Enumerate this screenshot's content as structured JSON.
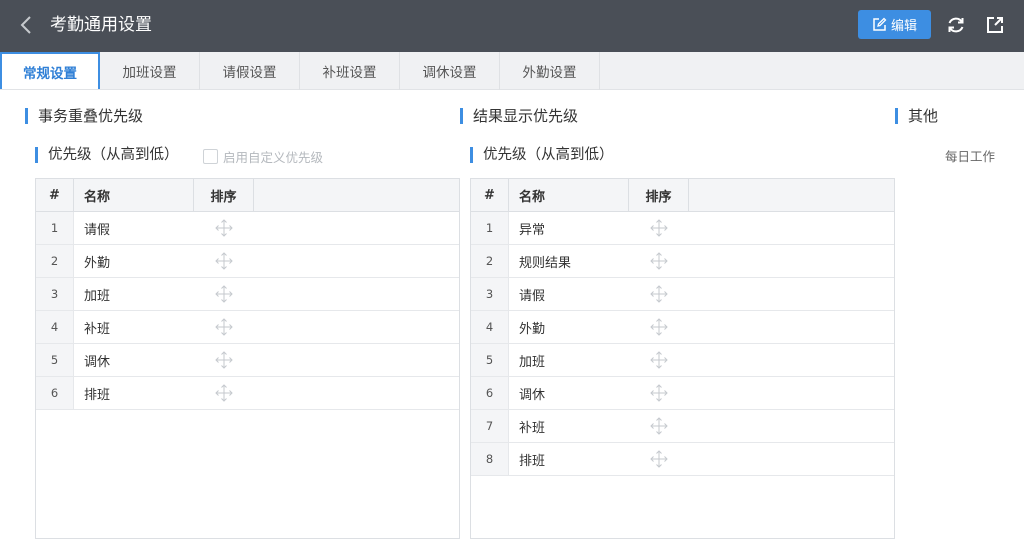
{
  "header": {
    "title": "考勤通用设置",
    "edit_label": "编辑",
    "back_icon": "chevron-left-icon",
    "refresh_icon": "refresh-icon",
    "export_icon": "external-link-icon"
  },
  "tabs": [
    {
      "label": "常规设置",
      "active": true
    },
    {
      "label": "加班设置"
    },
    {
      "label": "请假设置"
    },
    {
      "label": "补班设置"
    },
    {
      "label": "调休设置"
    },
    {
      "label": "外勤设置"
    }
  ],
  "left": {
    "section_title": "事务重叠优先级",
    "sub_title": "优先级（从高到低）",
    "custom_priority_label": "启用自定义优先级",
    "columns": {
      "num": "#",
      "name": "名称",
      "sort": "排序"
    },
    "rows": [
      {
        "num": "1",
        "name": "请假"
      },
      {
        "num": "2",
        "name": "外勤"
      },
      {
        "num": "3",
        "name": "加班"
      },
      {
        "num": "4",
        "name": "补班"
      },
      {
        "num": "5",
        "name": "调休"
      },
      {
        "num": "6",
        "name": "排班"
      }
    ]
  },
  "middle": {
    "section_title": "结果显示优先级",
    "sub_title": "优先级（从高到低）",
    "columns": {
      "num": "#",
      "name": "名称",
      "sort": "排序"
    },
    "rows": [
      {
        "num": "1",
        "name": "异常"
      },
      {
        "num": "2",
        "name": "规则结果"
      },
      {
        "num": "3",
        "name": "请假"
      },
      {
        "num": "4",
        "name": "外勤"
      },
      {
        "num": "5",
        "name": "加班"
      },
      {
        "num": "6",
        "name": "调休"
      },
      {
        "num": "7",
        "name": "补班"
      },
      {
        "num": "8",
        "name": "排班"
      }
    ]
  },
  "right": {
    "section_title": "其他",
    "item_text": "每日工作"
  },
  "colors": {
    "header_bg": "#4a4f57",
    "accent": "#3d8ee2"
  }
}
